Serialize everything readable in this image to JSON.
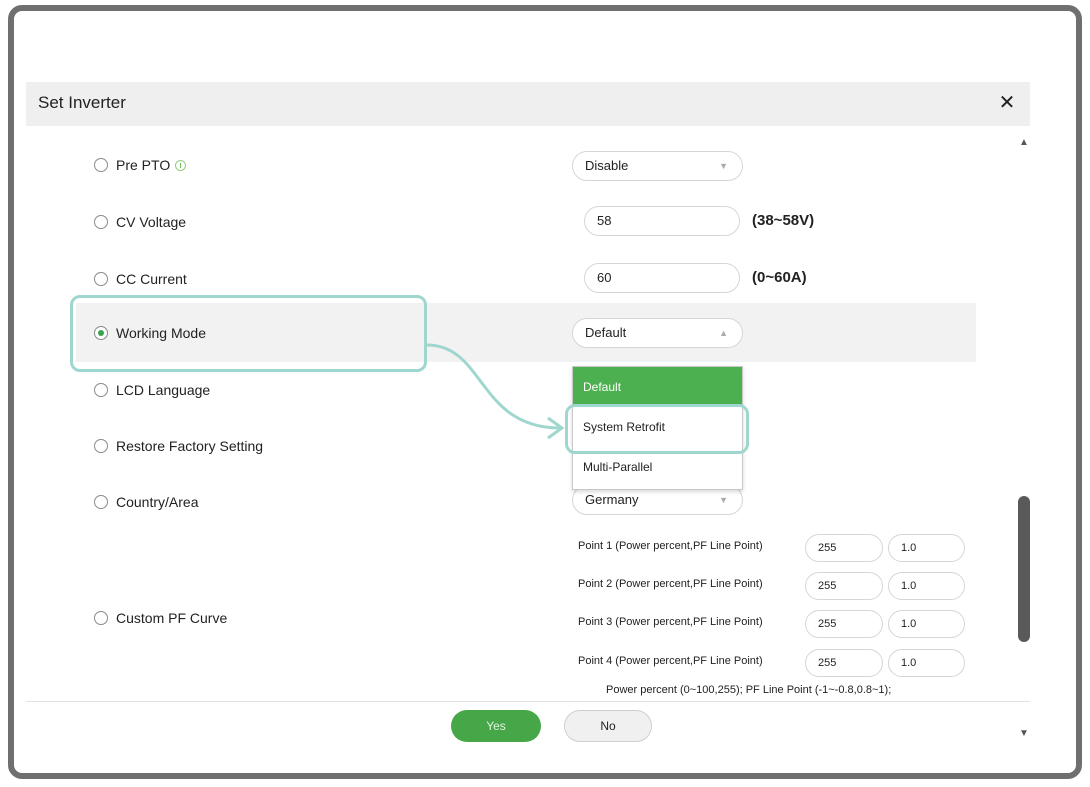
{
  "dialog": {
    "title": "Set Inverter",
    "close_glyph": "✕"
  },
  "scrollbar": {
    "up_glyph": "▲",
    "down_glyph": "▼"
  },
  "options": {
    "pre_pto": {
      "label": "Pre PTO",
      "value": "Disable"
    },
    "cv_voltage": {
      "label": "CV Voltage",
      "value": "58",
      "range": "(38~58V)"
    },
    "cc_current": {
      "label": "CC Current",
      "value": "60",
      "range": "(0~60A)"
    },
    "working_mode": {
      "label": "Working Mode",
      "value": "Default",
      "selected": true
    },
    "lcd_language": {
      "label": "LCD Language"
    },
    "restore_factory": {
      "label": "Restore Factory Setting"
    },
    "country_area": {
      "label": "Country/Area",
      "value": "Germany"
    },
    "custom_pf_curve": {
      "label": "Custom PF Curve"
    }
  },
  "dropdown": {
    "items": [
      "Default",
      "System Retrofit",
      "Multi-Parallel"
    ],
    "active_index": 0
  },
  "pf_points": [
    {
      "label": "Point 1 (Power percent,PF Line Point)",
      "power": "255",
      "pf": "1.0"
    },
    {
      "label": "Point 2 (Power percent,PF Line Point)",
      "power": "255",
      "pf": "1.0"
    },
    {
      "label": "Point 3 (Power percent,PF Line Point)",
      "power": "255",
      "pf": "1.0"
    },
    {
      "label": "Point 4 (Power percent,PF Line Point)",
      "power": "255",
      "pf": "1.0"
    }
  ],
  "pf_note": "Power percent (0~100,255);   PF Line Point (-1~-0.8,0.8~1);",
  "footer": {
    "yes_label": "Yes",
    "no_label": "No"
  },
  "colors": {
    "accent_green": "#4caf50",
    "highlight_teal": "#9fd7cf"
  }
}
